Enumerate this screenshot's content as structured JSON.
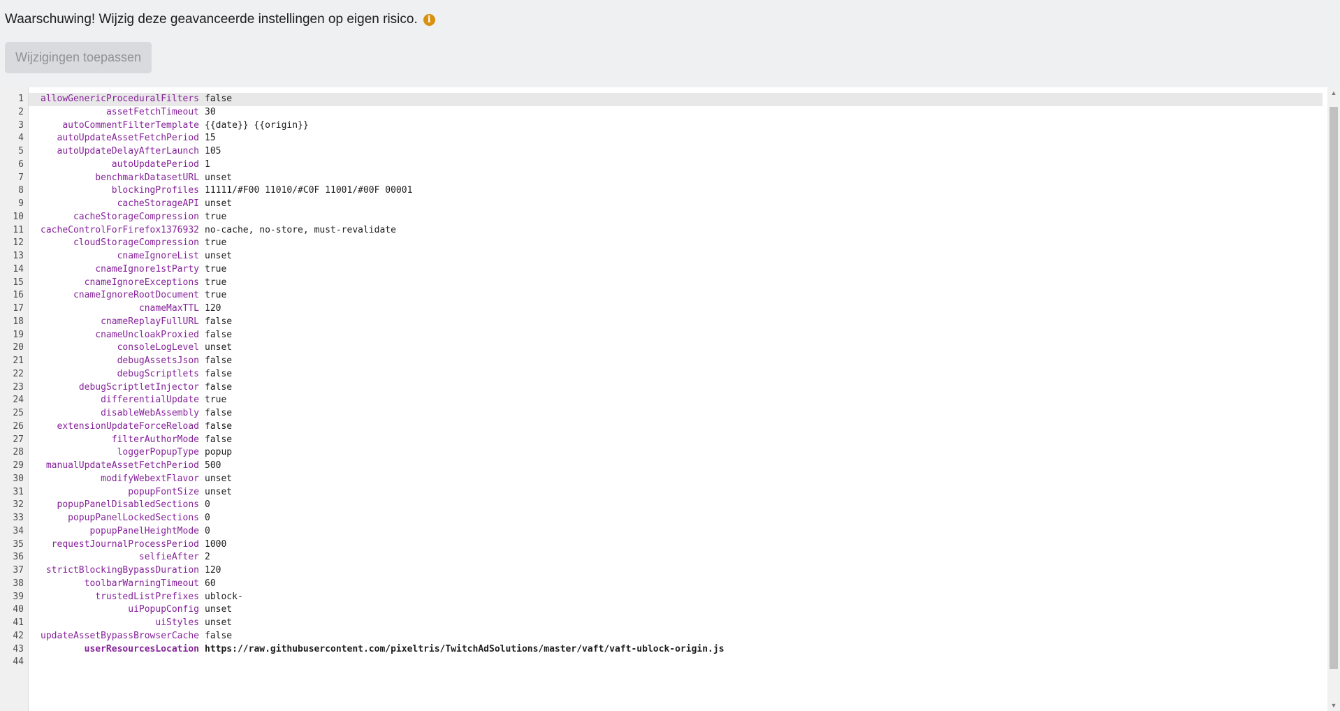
{
  "header": {
    "warning_text": "Waarschuwing! Wijzig deze geavanceerde instellingen op eigen risico.",
    "info_icon": "info-circle-icon",
    "apply_label": "Wijzigingen toepassen",
    "warning_color": "#d9900f"
  },
  "editor": {
    "active_line": 1,
    "lines": [
      {
        "n": "1",
        "key": "allowGenericProceduralFilters",
        "value": "false"
      },
      {
        "n": "2",
        "key": "assetFetchTimeout",
        "value": "30"
      },
      {
        "n": "3",
        "key": "autoCommentFilterTemplate",
        "value": "{{date}} {{origin}}"
      },
      {
        "n": "4",
        "key": "autoUpdateAssetFetchPeriod",
        "value": "15"
      },
      {
        "n": "5",
        "key": "autoUpdateDelayAfterLaunch",
        "value": "105"
      },
      {
        "n": "6",
        "key": "autoUpdatePeriod",
        "value": "1"
      },
      {
        "n": "7",
        "key": "benchmarkDatasetURL",
        "value": "unset"
      },
      {
        "n": "8",
        "key": "blockingProfiles",
        "value": "11111/#F00 11010/#C0F 11001/#00F 00001"
      },
      {
        "n": "9",
        "key": "cacheStorageAPI",
        "value": "unset"
      },
      {
        "n": "10",
        "key": "cacheStorageCompression",
        "value": "true"
      },
      {
        "n": "11",
        "key": "cacheControlForFirefox1376932",
        "value": "no-cache, no-store, must-revalidate"
      },
      {
        "n": "12",
        "key": "cloudStorageCompression",
        "value": "true"
      },
      {
        "n": "13",
        "key": "cnameIgnoreList",
        "value": "unset"
      },
      {
        "n": "14",
        "key": "cnameIgnore1stParty",
        "value": "true"
      },
      {
        "n": "15",
        "key": "cnameIgnoreExceptions",
        "value": "true"
      },
      {
        "n": "16",
        "key": "cnameIgnoreRootDocument",
        "value": "true"
      },
      {
        "n": "17",
        "key": "cnameMaxTTL",
        "value": "120"
      },
      {
        "n": "18",
        "key": "cnameReplayFullURL",
        "value": "false"
      },
      {
        "n": "19",
        "key": "cnameUncloakProxied",
        "value": "false"
      },
      {
        "n": "20",
        "key": "consoleLogLevel",
        "value": "unset"
      },
      {
        "n": "21",
        "key": "debugAssetsJson",
        "value": "false"
      },
      {
        "n": "22",
        "key": "debugScriptlets",
        "value": "false"
      },
      {
        "n": "23",
        "key": "debugScriptletInjector",
        "value": "false"
      },
      {
        "n": "24",
        "key": "differentialUpdate",
        "value": "true"
      },
      {
        "n": "25",
        "key": "disableWebAssembly",
        "value": "false"
      },
      {
        "n": "26",
        "key": "extensionUpdateForceReload",
        "value": "false"
      },
      {
        "n": "27",
        "key": "filterAuthorMode",
        "value": "false"
      },
      {
        "n": "28",
        "key": "loggerPopupType",
        "value": "popup"
      },
      {
        "n": "29",
        "key": "manualUpdateAssetFetchPeriod",
        "value": "500"
      },
      {
        "n": "30",
        "key": "modifyWebextFlavor",
        "value": "unset"
      },
      {
        "n": "31",
        "key": "popupFontSize",
        "value": "unset"
      },
      {
        "n": "32",
        "key": "popupPanelDisabledSections",
        "value": "0"
      },
      {
        "n": "33",
        "key": "popupPanelLockedSections",
        "value": "0"
      },
      {
        "n": "34",
        "key": "popupPanelHeightMode",
        "value": "0"
      },
      {
        "n": "35",
        "key": "requestJournalProcessPeriod",
        "value": "1000"
      },
      {
        "n": "36",
        "key": "selfieAfter",
        "value": "2"
      },
      {
        "n": "37",
        "key": "strictBlockingBypassDuration",
        "value": "120"
      },
      {
        "n": "38",
        "key": "toolbarWarningTimeout",
        "value": "60"
      },
      {
        "n": "39",
        "key": "trustedListPrefixes",
        "value": "ublock-"
      },
      {
        "n": "40",
        "key": "uiPopupConfig",
        "value": "unset"
      },
      {
        "n": "41",
        "key": "uiStyles",
        "value": "unset"
      },
      {
        "n": "42",
        "key": "updateAssetBypassBrowserCache",
        "value": "false"
      },
      {
        "n": "43",
        "key": "userResourcesLocation",
        "value": "https://raw.githubusercontent.com/pixeltris/TwitchAdSolutions/master/vaft/vaft-ublock-origin.js",
        "bold": true
      },
      {
        "n": "44",
        "key": "",
        "value": ""
      }
    ]
  }
}
